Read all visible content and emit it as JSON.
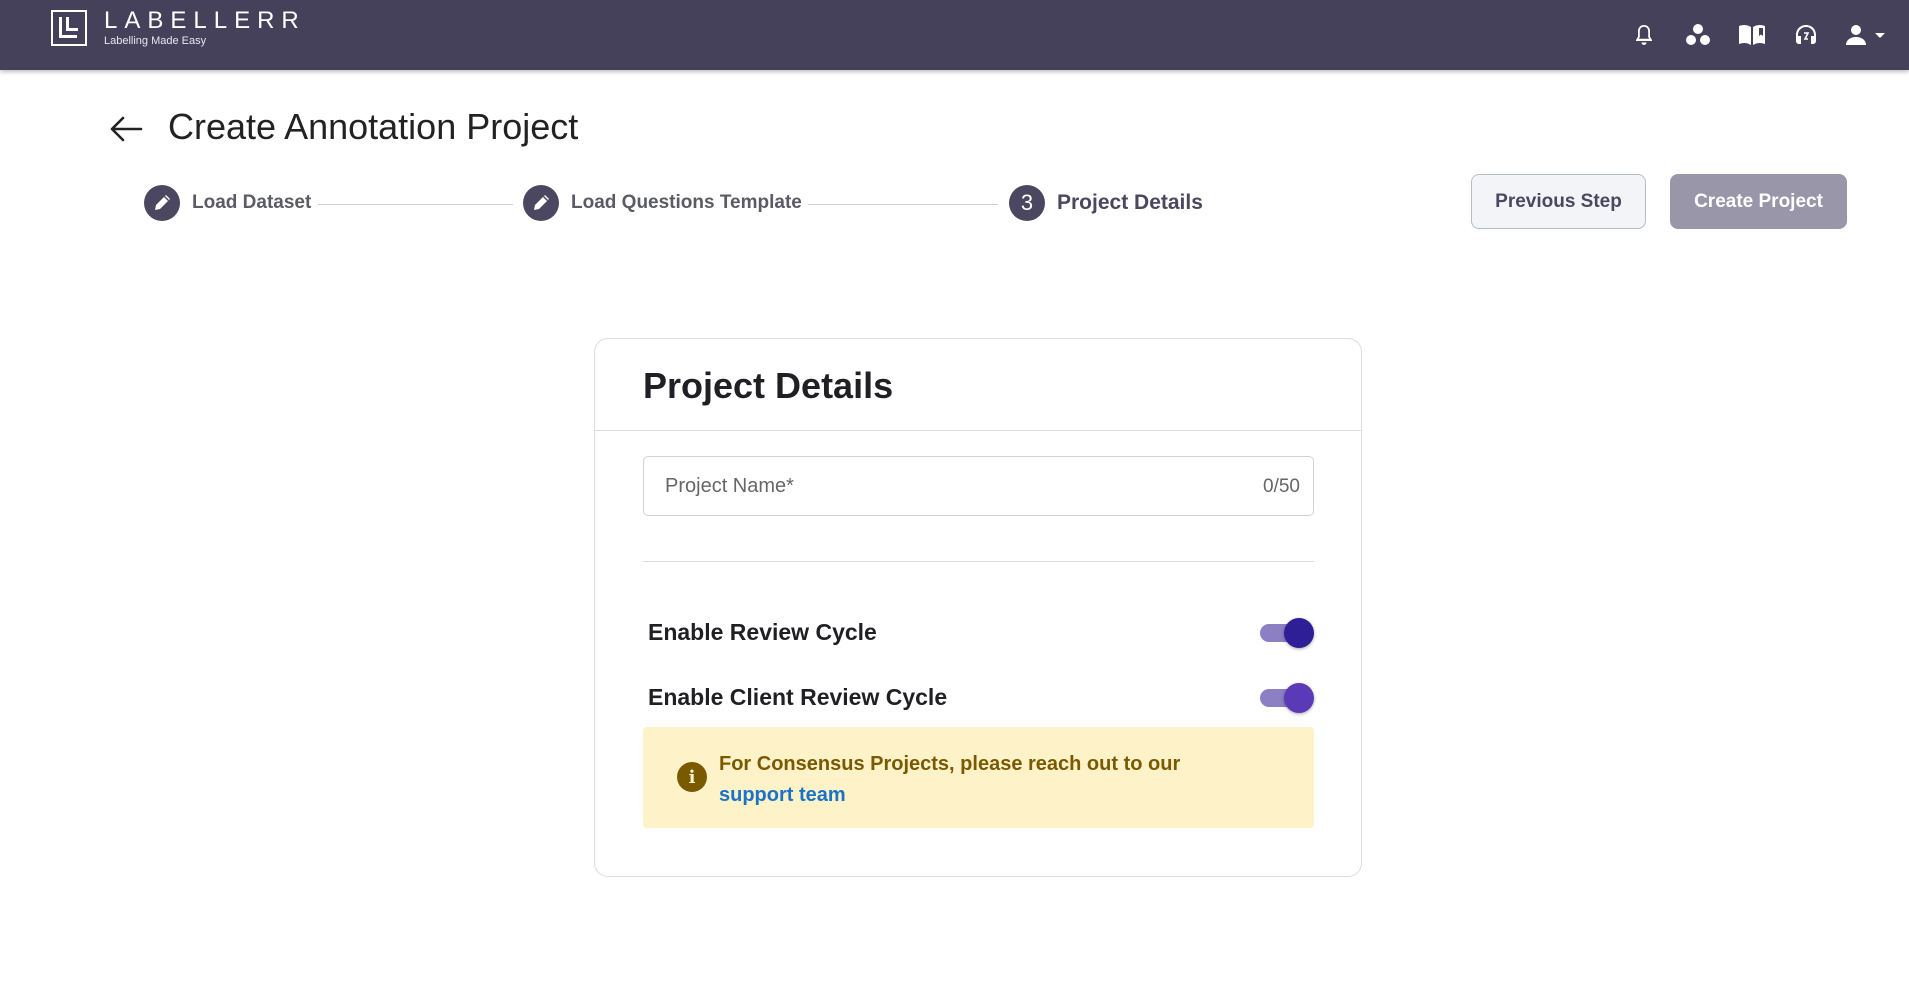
{
  "header": {
    "brand_name": "LABELLERR",
    "brand_tagline": "Labelling Made Easy",
    "icons": [
      "bell-icon",
      "workspace-icon",
      "docs-book-icon",
      "support-headset-icon",
      "user-account-icon",
      "chevron-down-icon"
    ]
  },
  "page": {
    "title": "Create Annotation Project"
  },
  "stepper": {
    "steps": [
      {
        "label": "Load Dataset",
        "state": "completed",
        "icon": "pencil-icon"
      },
      {
        "label": "Load Questions Template",
        "state": "completed",
        "icon": "pencil-icon"
      },
      {
        "label": "Project Details",
        "state": "active",
        "number": "3"
      }
    ]
  },
  "actions": {
    "previous_label": "Previous Step",
    "create_label": "Create Project"
  },
  "card": {
    "title": "Project Details",
    "project_name": {
      "label": "Project Name*",
      "value": "",
      "counter": "0/50"
    },
    "toggles": [
      {
        "label": "Enable Review Cycle",
        "on": true,
        "thumb_color": "#2f1f96"
      },
      {
        "label": "Enable Client Review Cycle",
        "on": true,
        "thumb_color": "#5b3ab8"
      }
    ],
    "info": {
      "icon": "info-icon",
      "text": "For Consensus Projects, please reach out to our",
      "link_text": "support team"
    }
  },
  "colors": {
    "topbar": "#45415b",
    "accent": "#4b4760",
    "toggle_track": "#8c7fc4",
    "info_bg": "#fef2c9",
    "info_text": "#7a5a00",
    "link": "#1a73c7"
  }
}
